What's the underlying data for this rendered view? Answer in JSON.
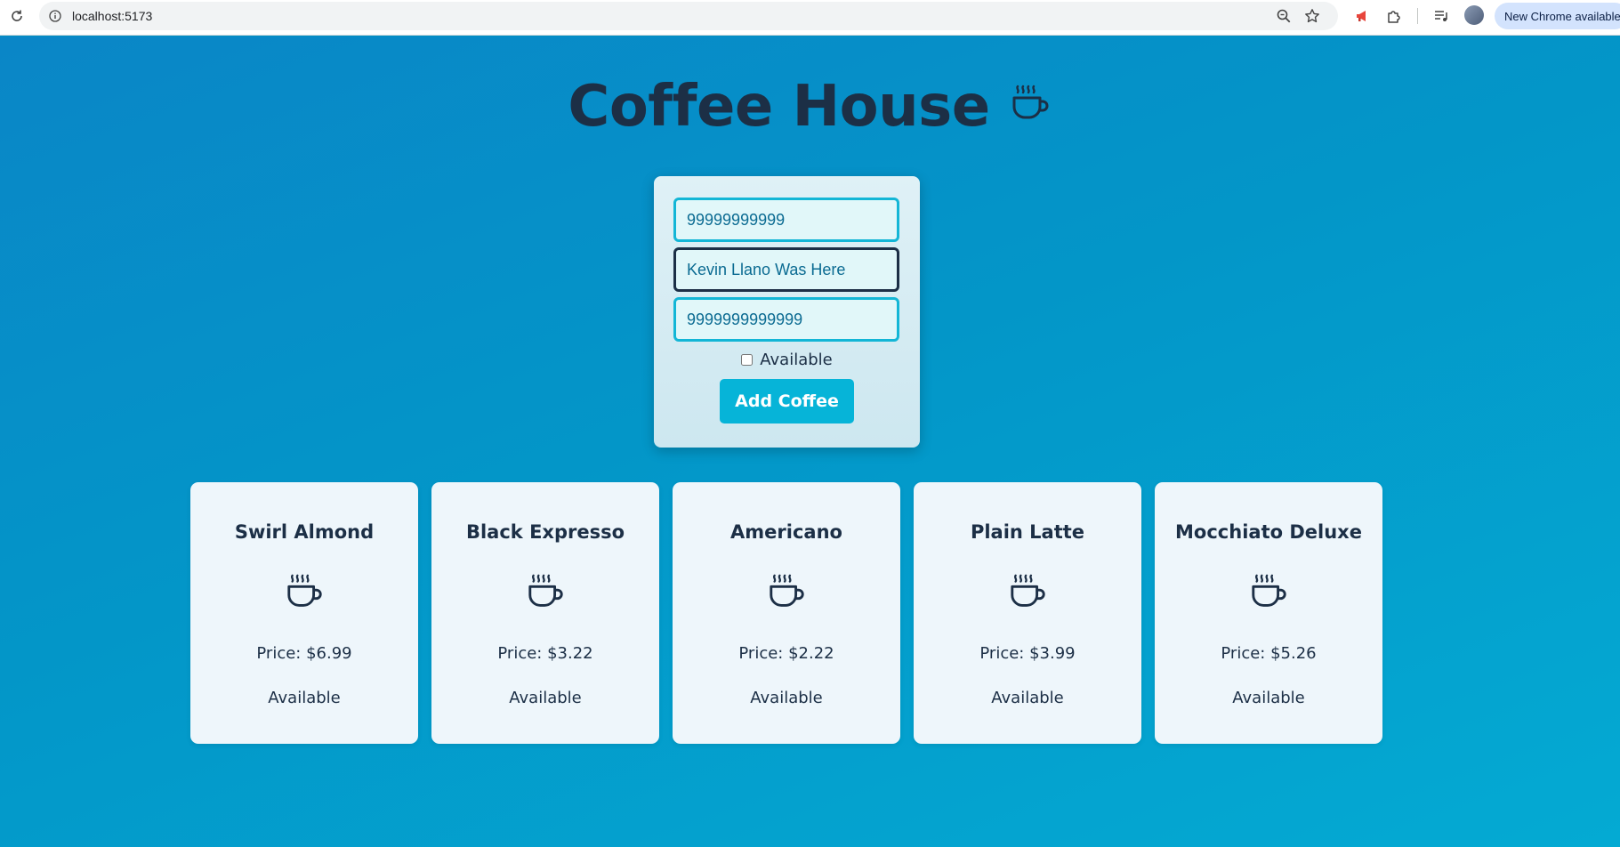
{
  "browser": {
    "url": "localhost:5173",
    "update_badge": "New Chrome available"
  },
  "page": {
    "title": "Coffee House",
    "title_icon": "coffee-cup-icon"
  },
  "form": {
    "field1_value": "99999999999",
    "field2_value": "Kevin Llano Was Here",
    "field3_value": "9999999999999",
    "available_label": "Available",
    "available_checked": false,
    "submit_label": "Add Coffee"
  },
  "coffees": [
    {
      "name": "Swirl Almond",
      "price": "Price: $6.99",
      "status": "Available"
    },
    {
      "name": "Black Expresso",
      "price": "Price: $3.22",
      "status": "Available"
    },
    {
      "name": "Americano",
      "price": "Price: $2.22",
      "status": "Available"
    },
    {
      "name": "Plain Latte",
      "price": "Price: $3.99",
      "status": "Available"
    },
    {
      "name": "Mocchiato Deluxe",
      "price": "Price: $5.26",
      "status": "Available"
    }
  ],
  "colors": {
    "background": "#0396c8",
    "title_text": "#1c2f46",
    "card_background": "#eef6fb",
    "accent_button": "#06b4d8",
    "input_border": "#13b6d6"
  }
}
